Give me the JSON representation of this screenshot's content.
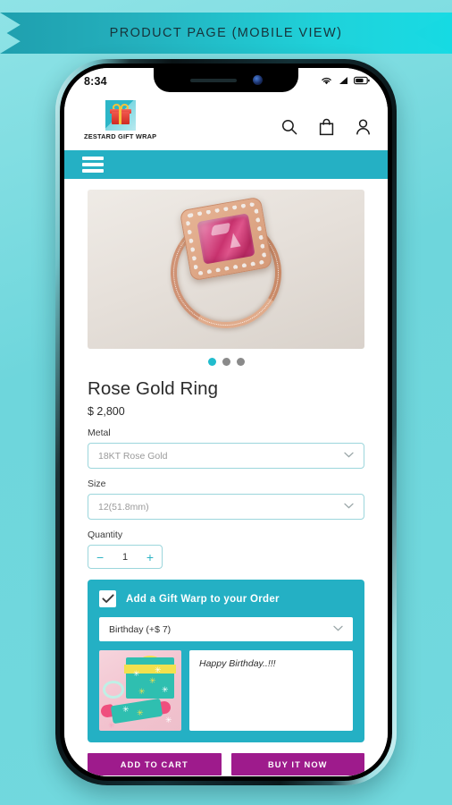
{
  "banner": {
    "label": "PRODUCT PAGE (MOBILE VIEW)"
  },
  "phone": {
    "status": {
      "time": "8:34",
      "wifi_icon": "wifi-icon",
      "signal_icon": "signal-icon",
      "battery_icon": "battery-icon"
    }
  },
  "header": {
    "logo_icon": "gift-box-logo-icon",
    "brand_name": "ZESTARD GIFT WRAP",
    "icons": [
      {
        "name": "search-icon",
        "label": "Search"
      },
      {
        "name": "shopping-bag-icon",
        "label": "Cart"
      },
      {
        "name": "account-icon",
        "label": "Account"
      }
    ]
  },
  "nav": {
    "menu_icon": "hamburger-menu-icon"
  },
  "gallery": {
    "product_image_alt": "Rose Gold Ring with pink cushion-cut gemstone",
    "dots": [
      {
        "active": true
      },
      {
        "active": false
      },
      {
        "active": false
      }
    ]
  },
  "product": {
    "title": "Rose Gold Ring",
    "price": "$ 2,800",
    "metal": {
      "label": "Metal",
      "value": "18KT Rose Gold",
      "chevron": "chevron-down-icon"
    },
    "size": {
      "label": "Size",
      "value": "12(51.8mm)",
      "chevron": "chevron-down-icon"
    },
    "quantity": {
      "label": "Quantity",
      "value": "1",
      "minus": "−",
      "plus": "+"
    }
  },
  "gift_wrap": {
    "checkbox_checked": true,
    "title": "Add a Gift Warp to your Order",
    "option": "Birthday  (+$ 7)",
    "chevron": "chevron-down-icon",
    "thumb_alt": "Teal gift boxes with yellow ribbon",
    "message": "Happy Birthday..!!!"
  },
  "cta": {
    "add_to_cart": "ADD TO CART",
    "buy_it_now": "BUY IT NOW"
  },
  "colors": {
    "background": "#6ed6dc",
    "teal": "#24b0c4",
    "accent_dot": "#21bccd",
    "cta_magenta": "#9e1b8c",
    "border_teal": "#9cd6dc"
  }
}
